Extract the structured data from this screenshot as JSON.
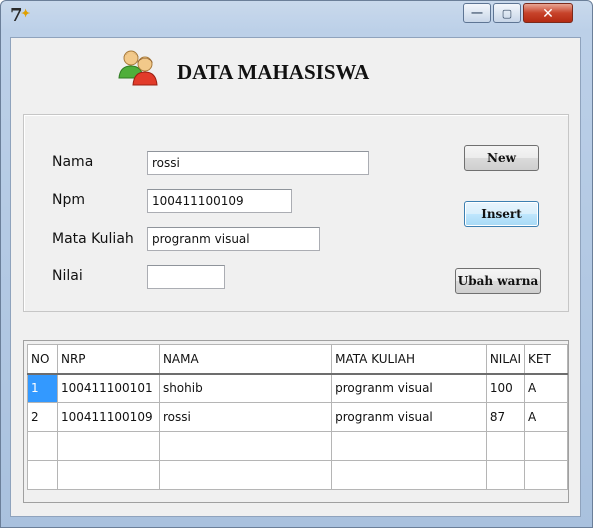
{
  "window": {
    "icon": "app-icon",
    "controls": {
      "minimize": "—",
      "maximize": "▢",
      "close": "✕"
    }
  },
  "header": {
    "title": "DATA MAHASISWA",
    "icon": "users-icon"
  },
  "form": {
    "nama_label": "Nama",
    "nama_value": "rossi",
    "npm_label": "Npm",
    "npm_value": "100411100109",
    "matkul_label": "Mata Kuliah",
    "matkul_value": "progranm visual",
    "nilai_label": "Nilai",
    "nilai_value": ""
  },
  "buttons": {
    "new": "New",
    "insert": "Insert",
    "ubah_warna": "Ubah warna"
  },
  "table": {
    "headers": [
      "NO",
      "NRP",
      "NAMA",
      "MATA KULIAH",
      "NILAI",
      "KET"
    ],
    "rows": [
      [
        "1",
        "100411100101",
        "shohib",
        "progranm visual",
        "100",
        "A"
      ],
      [
        "2",
        "100411100109",
        "rossi",
        "progranm visual",
        "87",
        "A"
      ],
      [
        "",
        "",
        "",
        "",
        "",
        ""
      ],
      [
        "",
        "",
        "",
        "",
        "",
        ""
      ]
    ],
    "selected_cell": "1"
  },
  "colors": {
    "selection": "#3399ff",
    "window_frame": "#bcd0e8",
    "close_button": "#c7432a"
  }
}
